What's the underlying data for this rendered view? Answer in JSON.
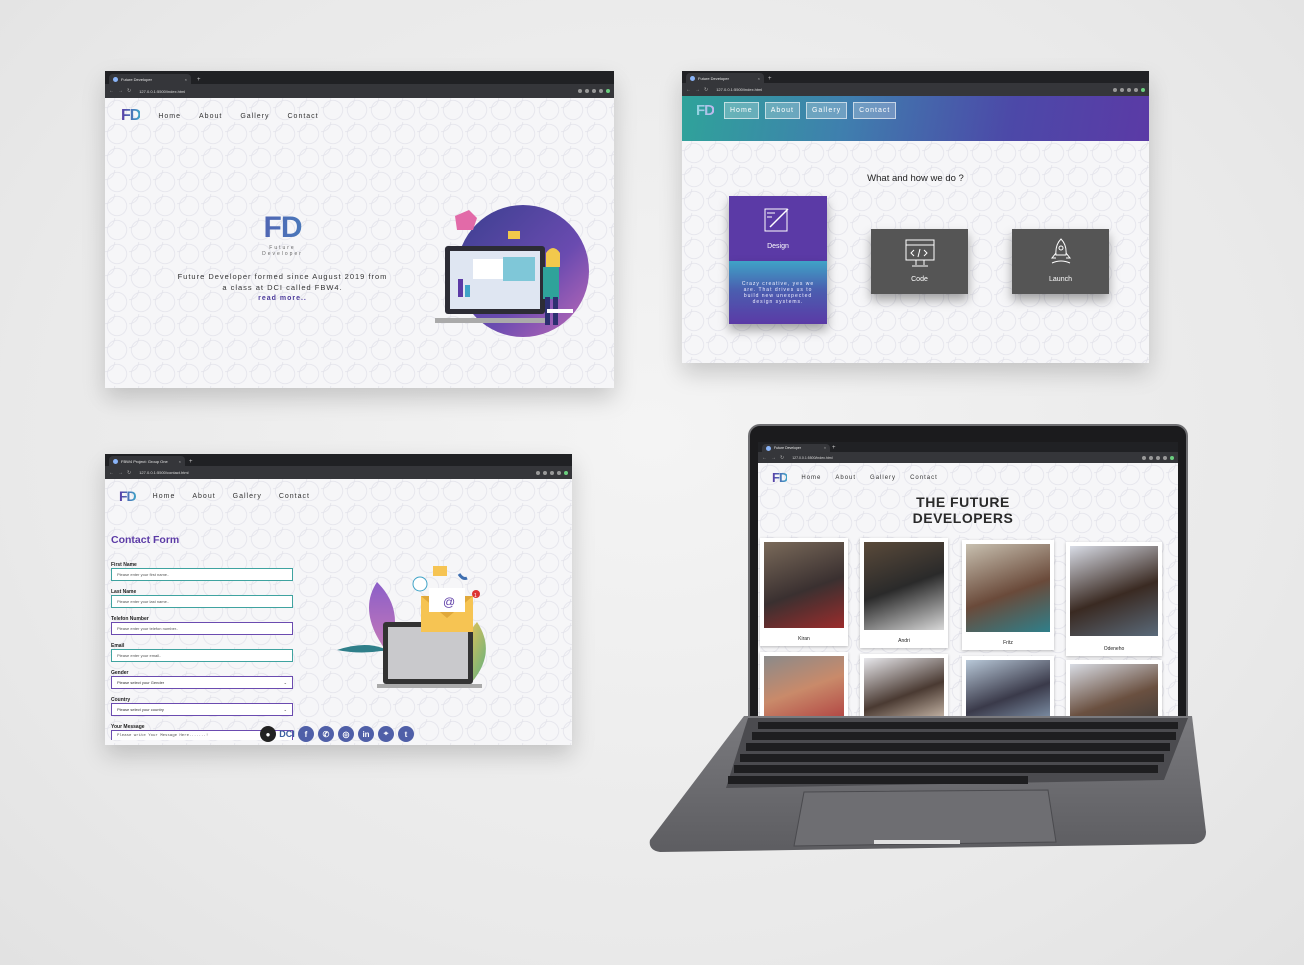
{
  "screen1": {
    "tab_title": "Future Developer",
    "url": "127.0.0.1:5500/index.html",
    "logo": "FD",
    "nav": [
      "Home",
      "About",
      "Gallery",
      "Contact"
    ],
    "hero_logo": "FD",
    "hero_sub_1": "Future",
    "hero_sub_2": "Developer",
    "description_1": "Future Developer formed since August 2019 from",
    "description_2": "a class at DCI called FBW4.",
    "read_more": "read more.."
  },
  "screen2": {
    "tab_title": "Future Developer",
    "url": "127.0.0.1:5500/index.html",
    "logo": "FD",
    "nav": [
      "Home",
      "About",
      "Gallery",
      "Contact"
    ],
    "question": "What and how we do ?",
    "cards": {
      "design": "Design",
      "design_back": "Crazy creative, yes we are. That drives us to build new unexpected design systems.",
      "code": "Code",
      "launch": "Launch"
    }
  },
  "screen3": {
    "tab_title": "FBW4 Project: Group One",
    "url": "127.0.0.1:5500/contact.html",
    "logo": "FD",
    "nav": [
      "Home",
      "About",
      "Gallery",
      "Contact"
    ],
    "form_title": "Contact Form",
    "fields": {
      "first_name_label": "First Name",
      "first_name_placeholder": "Please enter your first name..",
      "last_name_label": "Last Name",
      "last_name_placeholder": "Please enter your last name..",
      "phone_label": "Telefon Number",
      "phone_placeholder": "Please enter your telefon number..",
      "email_label": "Email",
      "email_placeholder": "Please enter your email..",
      "gender_label": "Gender",
      "gender_value": "Please select your Gender",
      "country_label": "Country",
      "country_value": "Please select your country",
      "message_label": "Your Message",
      "message_placeholder": "Please write Your Message Here.......!"
    },
    "dci_label": "DCI",
    "notification_count": "1"
  },
  "screen4": {
    "tab_title": "Future Developer",
    "url": "127.0.0.1:5500/index.html",
    "logo": "FD",
    "nav": [
      "Home",
      "About",
      "Gallery",
      "Contact"
    ],
    "title_1": "THE FUTURE",
    "title_2": "DEVELOPERS",
    "people": [
      "Kiran",
      "Andri",
      "Fritz",
      "Odeneho"
    ]
  },
  "colors": {
    "purple": "#5b3aa6",
    "teal": "#3fa3c7",
    "card_gray": "#555555"
  }
}
